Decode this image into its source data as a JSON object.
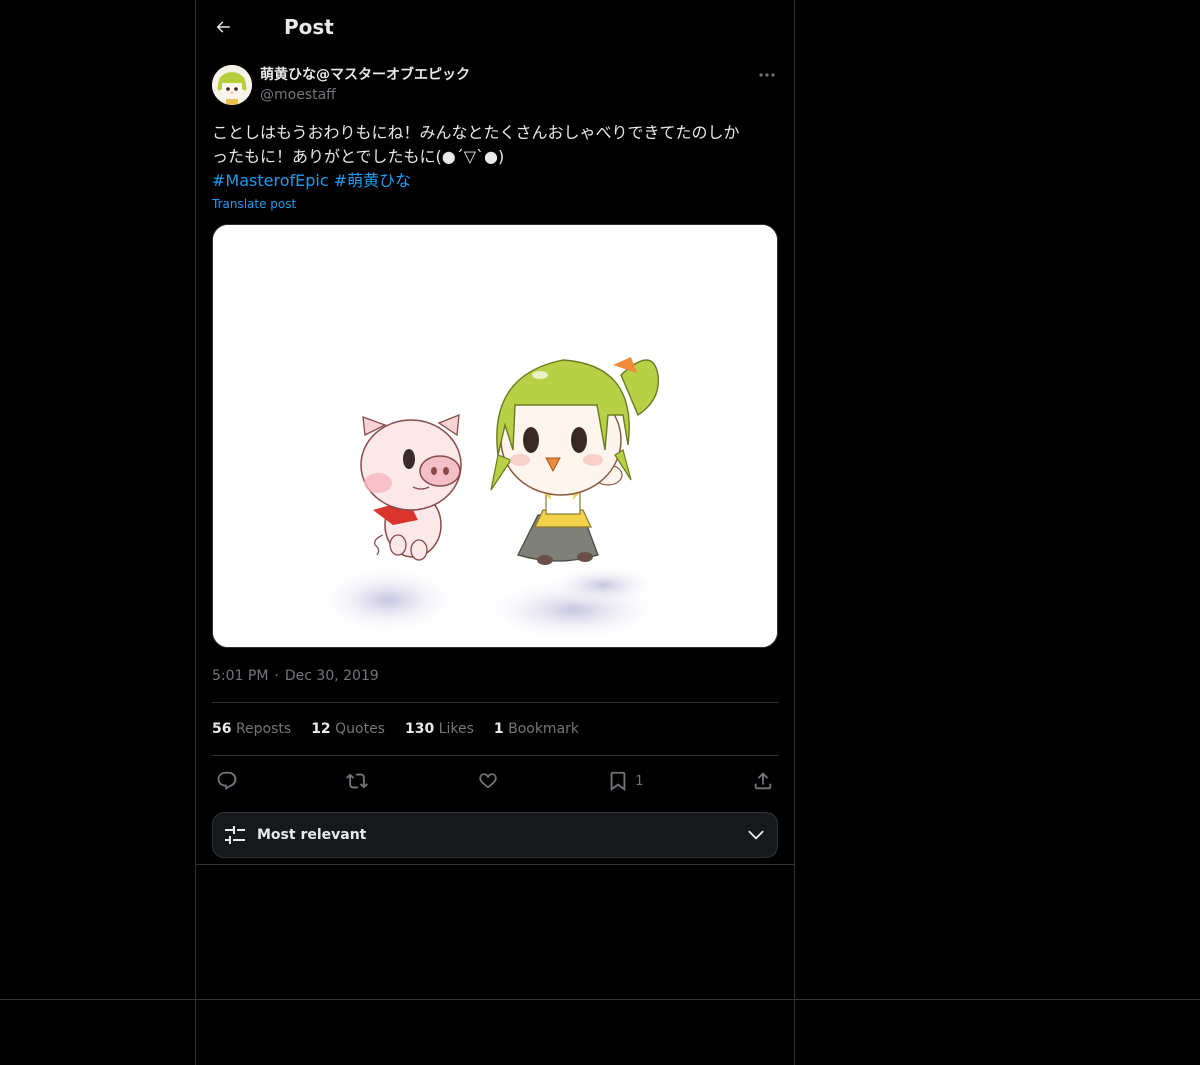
{
  "header": {
    "title": "Post"
  },
  "post": {
    "author": {
      "display_name": "萌黄ひな@マスターオブエピック",
      "handle": "@moestaff"
    },
    "text_line1": "ことしはもうおわりもにね！みんなとたくさんおしゃべりできてたのしか",
    "text_line2": "ったもに！ありがとでしたもに(●´▽`●)",
    "hashtags": [
      "#MasterofEpic",
      "#萌黄ひな"
    ],
    "translate_label": "Translate post",
    "time": "5:01 PM",
    "separator": "·",
    "date": "Dec 30, 2019"
  },
  "stats": {
    "reposts": {
      "count": "56",
      "label": "Reposts"
    },
    "quotes": {
      "count": "12",
      "label": "Quotes"
    },
    "likes": {
      "count": "130",
      "label": "Likes"
    },
    "bookmarks": {
      "count": "1",
      "label": "Bookmark"
    }
  },
  "actions": {
    "reply": {
      "icon": "reply-icon"
    },
    "repost": {
      "icon": "repost-icon"
    },
    "like": {
      "icon": "heart-icon"
    },
    "bookmark": {
      "icon": "bookmark-icon",
      "count": "1"
    },
    "share": {
      "icon": "share-icon"
    }
  },
  "sort": {
    "label": "Most relevant",
    "icon": "sliders-icon"
  },
  "colors": {
    "background": "#000000",
    "text": "#e7e9ea",
    "muted": "#71767b",
    "accent": "#1d9bf0",
    "border": "#2f3336"
  }
}
